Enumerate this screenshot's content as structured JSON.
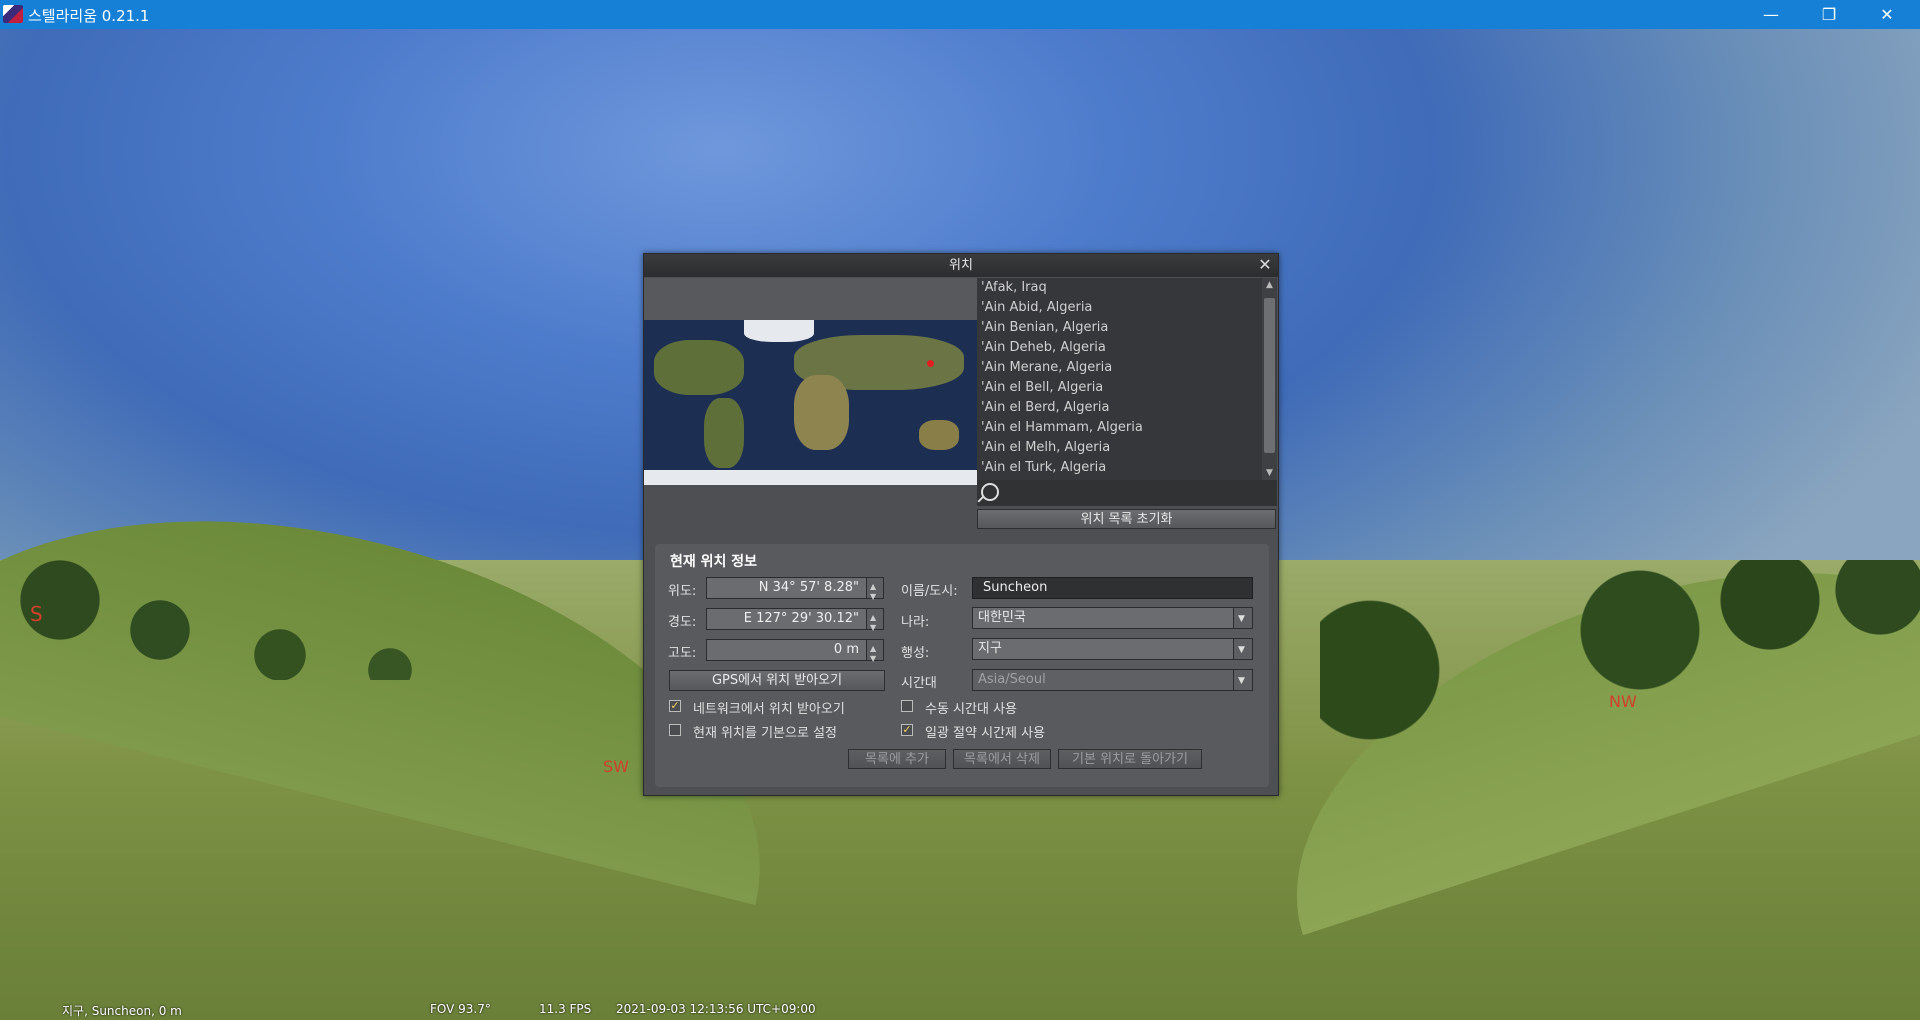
{
  "window": {
    "title": "스텔라리움 0.21.1",
    "minimize_glyph": "—",
    "restore_glyph": "❐",
    "close_glyph": "✕"
  },
  "sky": {
    "compass": {
      "s": "S",
      "sw": "SW",
      "nw": "NW"
    }
  },
  "statusbar": {
    "location": "지구, Suncheon, 0 m",
    "fov": "FOV 93.7°",
    "fps": "11.3 FPS",
    "datetime": "2021-09-03 12:13:56 UTC+09:00"
  },
  "dialog": {
    "title": "위치",
    "close_glyph": "✕",
    "location_list": [
      "'Afak, Iraq",
      "'Ain Abid, Algeria",
      "'Ain Benian, Algeria",
      "'Ain Deheb, Algeria",
      "'Ain Merane, Algeria",
      "'Ain el Bell, Algeria",
      "'Ain el Berd, Algeria",
      "'Ain el Hammam, Algeria",
      "'Ain el Melh, Algeria",
      "'Ain el Turk, Algeria"
    ],
    "reset_list_button": "위치 목록 초기화",
    "current_location": {
      "group_title": "현재 위치 정보",
      "latitude_label": "위도:",
      "latitude_value": "N 34° 57' 8.28\"",
      "longitude_label": "경도:",
      "longitude_value": "E 127° 29' 30.12\"",
      "altitude_label": "고도:",
      "altitude_value": "0 m",
      "gps_button": "GPS에서 위치 받아오기",
      "network_checkbox_label": "네트워크에서 위치 받아오기",
      "network_checked": true,
      "default_checkbox_label": "현재 위치를 기본으로 설정",
      "default_checked": false,
      "name_label": "이름/도시:",
      "name_value": "Suncheon",
      "country_label": "나라:",
      "country_value": "대한민국",
      "planet_label": "행성:",
      "planet_value": "지구",
      "timezone_label": "시간대",
      "timezone_value": "Asia/Seoul",
      "manual_tz_label": "수동 시간대 사용",
      "manual_tz_checked": false,
      "dst_label": "일광 절약 시간제 사용",
      "dst_checked": true,
      "add_button": "목록에 추가",
      "delete_button": "목록에서 삭제",
      "return_default_button": "기본 위치로 돌아가기"
    }
  }
}
